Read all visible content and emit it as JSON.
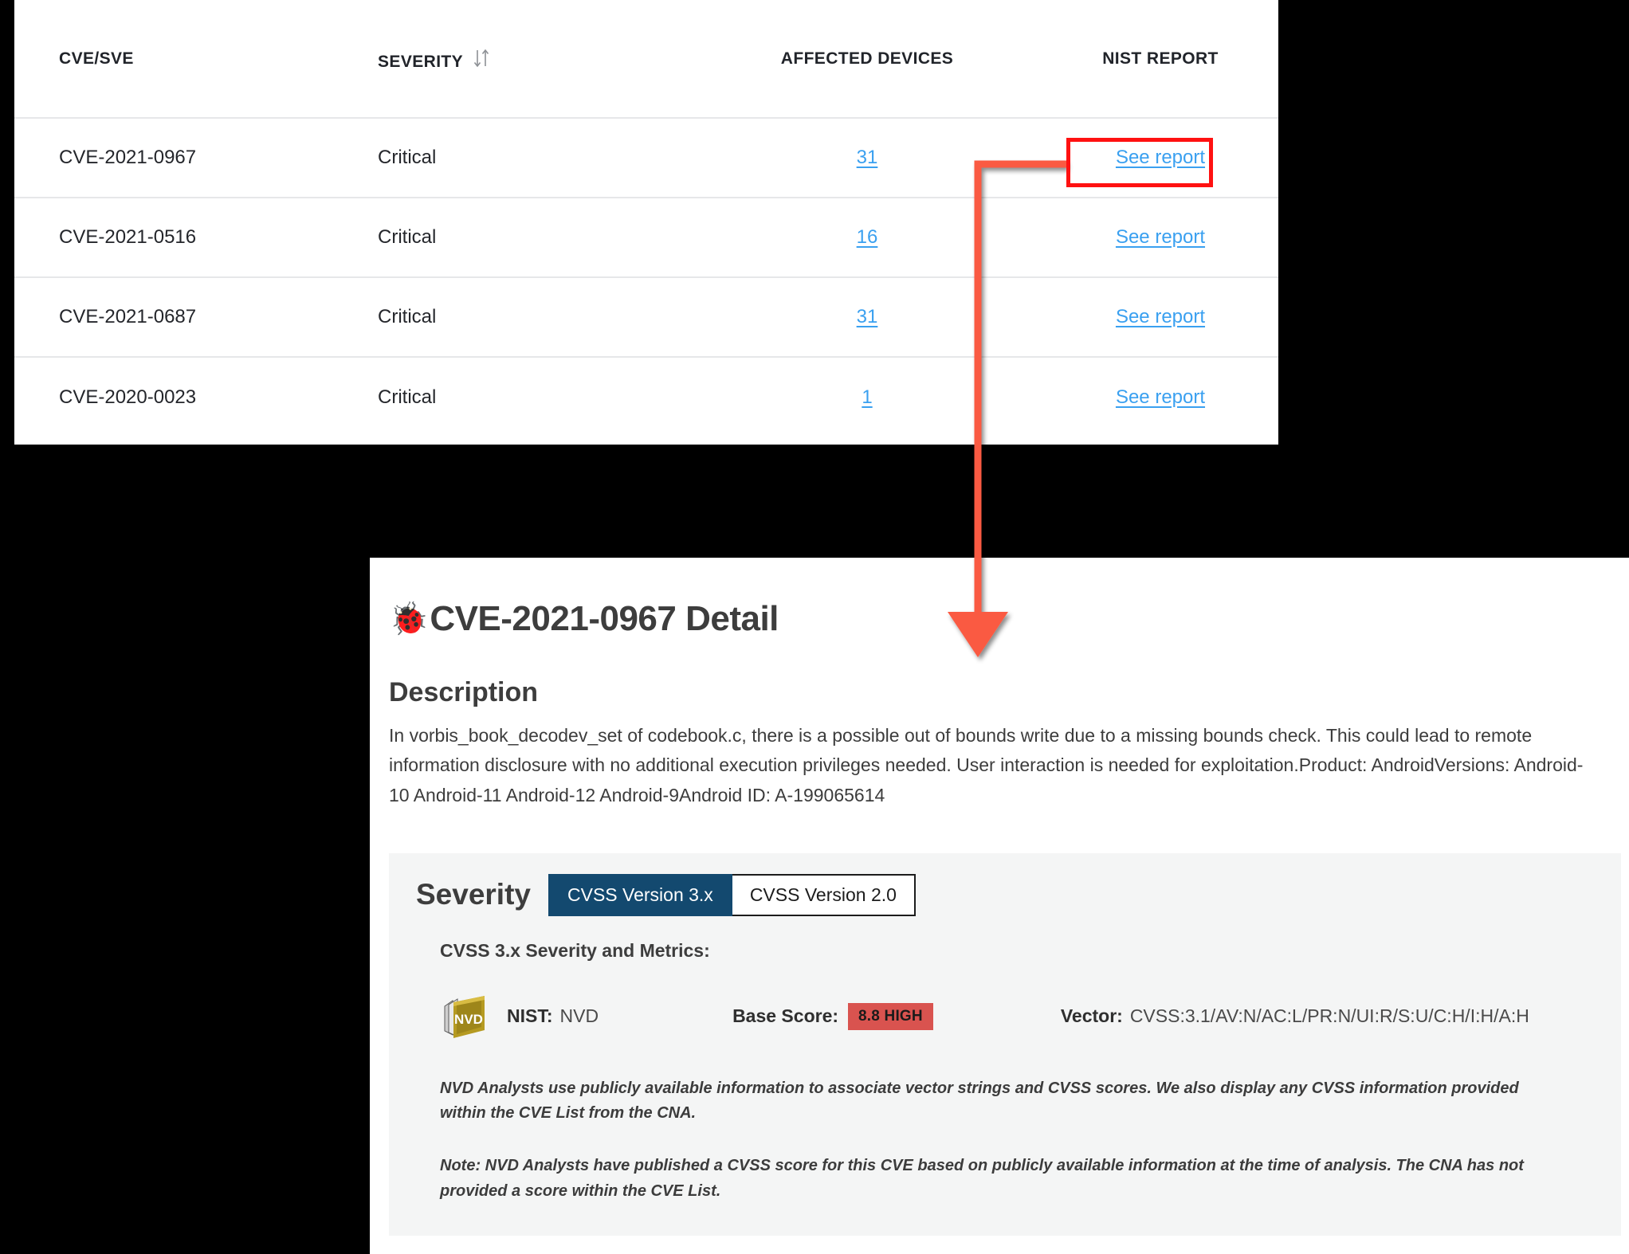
{
  "table": {
    "columns": [
      {
        "key": "cve",
        "label": "CVE/SVE",
        "sortable": false
      },
      {
        "key": "sev",
        "label": "SEVERITY",
        "sortable": true,
        "sort_icon": "sort-updown-icon"
      },
      {
        "key": "dev",
        "label": "AFFECTED DEVICES",
        "sortable": false
      },
      {
        "key": "nist",
        "label": "NIST REPORT",
        "sortable": false
      }
    ],
    "rows": [
      {
        "cve": "CVE-2021-0967",
        "severity": "Critical",
        "affected_devices": "31",
        "nist_report": "See report",
        "highlighted": true
      },
      {
        "cve": "CVE-2021-0516",
        "severity": "Critical",
        "affected_devices": "16",
        "nist_report": "See report",
        "highlighted": false
      },
      {
        "cve": "CVE-2021-0687",
        "severity": "Critical",
        "affected_devices": "31",
        "nist_report": "See report",
        "highlighted": false
      },
      {
        "cve": "CVE-2020-0023",
        "severity": "Critical",
        "affected_devices": "1",
        "nist_report": "See report",
        "highlighted": false
      }
    ]
  },
  "annotation": {
    "color": "#fa5a43",
    "highlight_color": "#ff1111",
    "type": "callout-arrow"
  },
  "detail": {
    "bug_icon": "🐞",
    "title": "CVE-2021-0967 Detail",
    "description_heading": "Description",
    "description": "In vorbis_book_decodev_set of codebook.c, there is a possible out of bounds write due to a missing bounds check. This could lead to remote information disclosure with no additional execution privileges needed. User interaction is needed for exploitation.Product: AndroidVersions: Android-10 Android-11 Android-12 Android-9Android ID: A-199065614",
    "severity": {
      "title": "Severity",
      "tabs": [
        {
          "label": "CVSS Version 3.x",
          "active": true
        },
        {
          "label": "CVSS Version 2.0",
          "active": false
        }
      ],
      "metrics_label": "CVSS 3.x Severity and Metrics:",
      "source_icon": "nvd-book-icon",
      "source_icon_text": "NVD",
      "nist_label": "NIST:",
      "nist_value": "NVD",
      "base_score_label": "Base Score:",
      "base_score_value": "8.8 HIGH",
      "base_score_color": "#d9534f",
      "vector_label": "Vector:",
      "vector_value": "CVSS:3.1/AV:N/AC:L/PR:N/UI:R/S:U/C:H/I:H/A:H",
      "note_1": "NVD Analysts use publicly available information to associate vector strings and CVSS scores. We also display any CVSS information provided within the CVE List from the CNA.",
      "note_2": "Note: NVD Analysts have published a CVSS score for this CVE based on publicly available information at the time of analysis. The CNA has not provided a score within the CVE List."
    }
  }
}
